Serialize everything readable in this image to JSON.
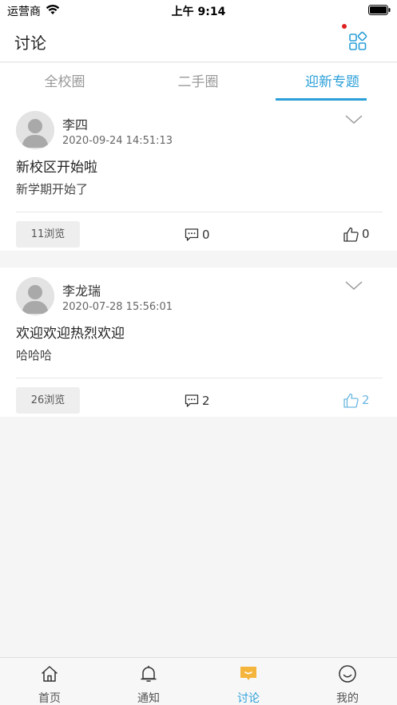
{
  "status_bar": {
    "carrier": "运营商",
    "time": "上午 9:14"
  },
  "header": {
    "title": "讨论"
  },
  "tabs": [
    {
      "label": "全校圈",
      "active": false
    },
    {
      "label": "二手圈",
      "active": false
    },
    {
      "label": "迎新专题",
      "active": true
    }
  ],
  "posts": [
    {
      "author": "李四",
      "time": "2020-09-24 14:51:13",
      "title": "新校区开始啦",
      "body": "新学期开始了",
      "views": "11浏览",
      "comments": "0",
      "likes": "0",
      "liked": false
    },
    {
      "author": "李龙瑞",
      "time": "2020-07-28 15:56:01",
      "title": "欢迎欢迎热烈欢迎",
      "body": "哈哈哈",
      "views": "26浏览",
      "comments": "2",
      "likes": "2",
      "liked": true
    }
  ],
  "bottom_nav": [
    {
      "label": "首页",
      "icon": "home-icon",
      "active": false
    },
    {
      "label": "通知",
      "icon": "bell-icon",
      "active": false
    },
    {
      "label": "讨论",
      "icon": "chat-icon",
      "active": true
    },
    {
      "label": "我的",
      "icon": "smiley-icon",
      "active": false
    }
  ],
  "colors": {
    "accent": "#2a9fd8",
    "liked": "#6cb7e0",
    "chat_icon": "#f5b53d",
    "badge_dot": "#e02020"
  }
}
